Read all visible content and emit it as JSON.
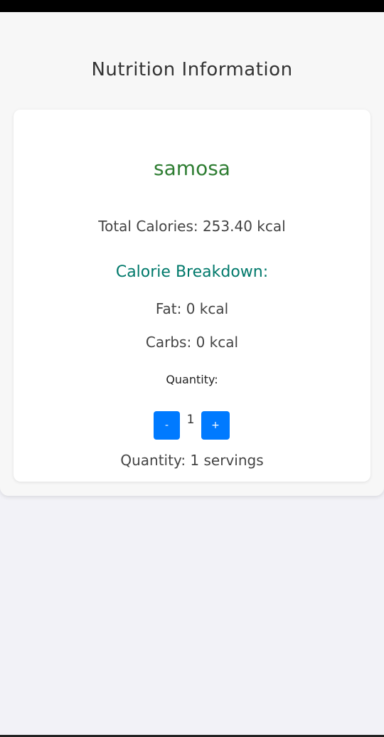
{
  "header": {
    "title": "Nutrition Information"
  },
  "food": {
    "name": "samosa",
    "total_calories": "Total Calories: 253.40 kcal",
    "breakdown_heading": "Calorie Breakdown:",
    "fat": "Fat: 0 kcal",
    "carbs": "Carbs: 0 kcal"
  },
  "quantity": {
    "label": "Quantity:",
    "decrement_label": "-",
    "value": "1",
    "increment_label": "+",
    "summary": "Quantity: 1 servings"
  },
  "colors": {
    "food_name": "#2e7d32",
    "breakdown_heading": "#00796b",
    "button": "#007aff"
  }
}
